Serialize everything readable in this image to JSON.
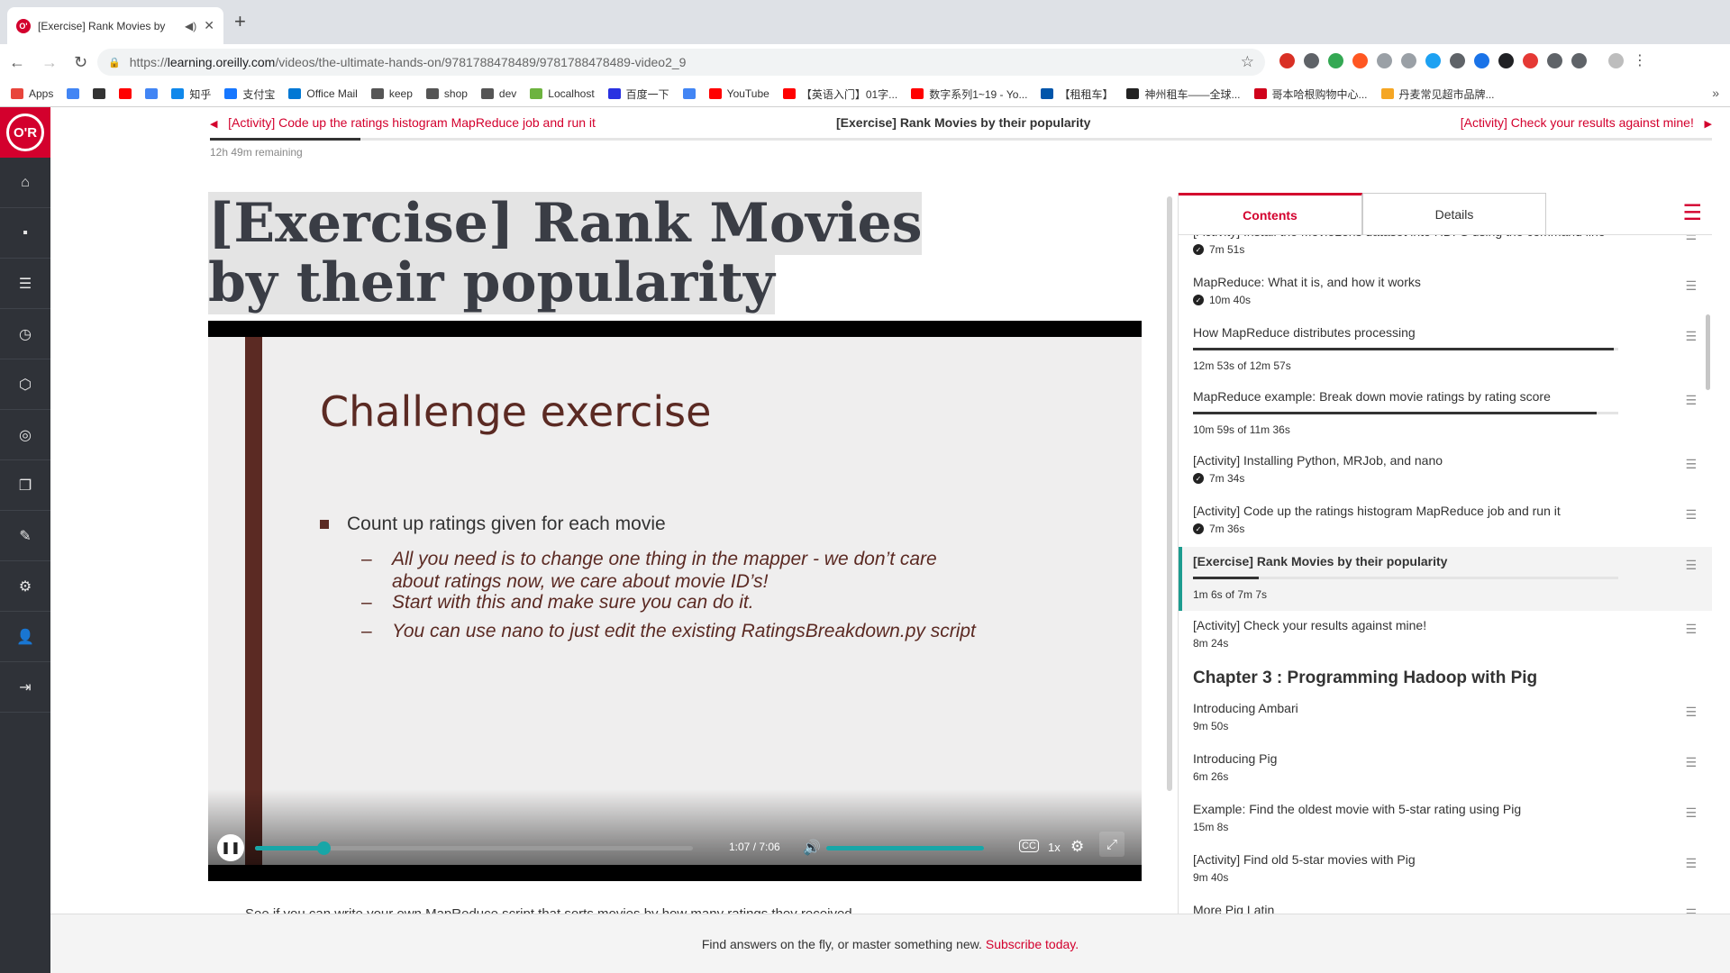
{
  "browser": {
    "tab_title": "[Exercise] Rank Movies by",
    "tab_favicon": "O'",
    "url_prefix": "https://",
    "url_host": "learning.oreilly.com",
    "url_path": "/videos/the-ultimate-hands-on/9781788478489/9781788478489-video2_9",
    "bookmarks": [
      {
        "label": "Apps",
        "color": "#e8453c"
      },
      {
        "label": "",
        "color": "#4285f4"
      },
      {
        "label": "",
        "color": "#333333"
      },
      {
        "label": "",
        "color": "#ff0000"
      },
      {
        "label": "",
        "color": "#4285f4"
      },
      {
        "label": "知乎",
        "color": "#0f88eb"
      },
      {
        "label": "支付宝",
        "color": "#1677ff"
      },
      {
        "label": "Office Mail",
        "color": "#0078d4"
      },
      {
        "label": "keep",
        "color": "#555555"
      },
      {
        "label": "shop",
        "color": "#555555"
      },
      {
        "label": "dev",
        "color": "#555555"
      },
      {
        "label": "Localhost",
        "color": "#6db33f"
      },
      {
        "label": "百度一下",
        "color": "#2932e1"
      },
      {
        "label": "",
        "color": "#4285f4"
      },
      {
        "label": "YouTube",
        "color": "#ff0000"
      },
      {
        "label": "【英语入门】01字...",
        "color": "#ff0000"
      },
      {
        "label": "数字系列1~19 - Yo...",
        "color": "#ff0000"
      },
      {
        "label": "【租租车】",
        "color": "#0055aa"
      },
      {
        "label": "神州租车——全球...",
        "color": "#222222"
      },
      {
        "label": "哥本哈根购物中心...",
        "color": "#d0021b"
      },
      {
        "label": "丹麦常见超市品牌...",
        "color": "#f5a623"
      }
    ]
  },
  "sidebar": {
    "logo": "O'R",
    "items": [
      "home-icon",
      "chat-icon",
      "list-icon",
      "history-icon",
      "hexagon-icon",
      "target-icon",
      "copy-icon",
      "pencil-icon",
      "gear-icon",
      "user-icon",
      "signout-icon"
    ]
  },
  "lesson_nav": {
    "prev": "[Activity] Code up the ratings histogram MapReduce job and run it",
    "current": "[Exercise] Rank Movies by their popularity",
    "next": "[Activity] Check your results against mine!",
    "remaining": "12h 49m remaining",
    "course_progress": 0.1
  },
  "page_title": "[Exercise] Rank Movies by their popularity",
  "slide": {
    "title": "Challenge exercise",
    "bullet": "Count up ratings given for each movie",
    "subbullets": [
      "All you need is to change one thing in the mapper - we don’t care about ratings now, we care about movie ID’s!",
      "Start with this and make sure you can do it.",
      "You can use nano to just edit the existing RatingsBreakdown.py script"
    ]
  },
  "player": {
    "time": "1:07 / 7:06",
    "played_fraction": 0.157,
    "volume_fraction": 1.0,
    "cc": "CC",
    "speed": "1x",
    "accent": "#18a6a7"
  },
  "description": "See if you can write your own MapReduce script that sorts movies by how many ratings they received.",
  "toc": {
    "tabs": [
      "Contents",
      "Details"
    ],
    "items": [
      {
        "title": "[Activity] Install the MovieLens dataset into HDFS using the command line",
        "meta": "7m 51s",
        "done": true
      },
      {
        "title": "MapReduce: What it is, and how it works",
        "meta": "10m 40s",
        "done": true
      },
      {
        "title": "How MapReduce distributes processing",
        "meta": "12m 53s of 12m 57s",
        "progress": 0.99
      },
      {
        "title": "MapReduce example: Break down movie ratings by rating score",
        "meta": "10m 59s of 11m 36s",
        "progress": 0.95
      },
      {
        "title": "[Activity] Installing Python, MRJob, and nano",
        "meta": "7m 34s",
        "done": true
      },
      {
        "title": "[Activity] Code up the ratings histogram MapReduce job and run it",
        "meta": "7m 36s",
        "done": true
      },
      {
        "title": "[Exercise] Rank Movies by their popularity",
        "meta": "1m 6s of 7m 7s",
        "progress": 0.155,
        "active": true
      },
      {
        "title": "[Activity] Check your results against mine!",
        "meta": "8m 24s"
      }
    ],
    "chapter": "Chapter 3 : Programming Hadoop with Pig",
    "chapter_items": [
      {
        "title": "Introducing Ambari",
        "meta": "9m 50s"
      },
      {
        "title": "Introducing Pig",
        "meta": "6m 26s"
      },
      {
        "title": "Example: Find the oldest movie with 5-star rating using Pig",
        "meta": "15m 8s"
      },
      {
        "title": "[Activity] Find old 5-star movies with Pig",
        "meta": "9m 40s"
      },
      {
        "title": "More Pig Latin",
        "meta": ""
      }
    ]
  },
  "banner": {
    "text": "Find answers on the fly, or master something new.",
    "link": "Subscribe today."
  },
  "colors": {
    "brand": "#d3002d",
    "sidebar": "#2f3238",
    "slide_accent": "#5b2a23"
  }
}
